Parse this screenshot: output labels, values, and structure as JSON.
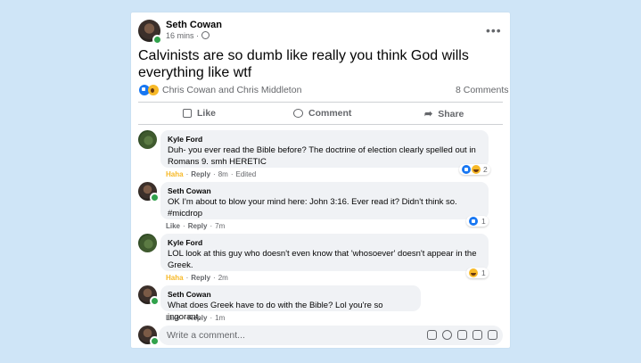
{
  "colors": {
    "background": "#cfe5f7",
    "haha": "#f7b928",
    "like": "#1877f2",
    "online": "#31a24c"
  },
  "post": {
    "author": "Seth Cowan",
    "time": "16 mins",
    "privacy_icon": "globe-icon",
    "more_label": "•••",
    "text": "Calvinists are so dumb like really you think God wills everything like wtf",
    "reactors": "Chris Cowan and Chris Middleton",
    "comments_count": "8 Comments",
    "actions": {
      "like": "Like",
      "comment": "Comment",
      "share": "Share"
    }
  },
  "comments": [
    {
      "author": "Kyle Ford",
      "text": "Duh- you ever read the Bible before? The doctrine of election clearly spelled out in Romans 9. smh HERETIC",
      "action": "Haha",
      "reply": "Reply",
      "time": "8m",
      "extra": "Edited",
      "reaction_count": "2"
    },
    {
      "author": "Seth Cowan",
      "text": "OK I'm about to blow your mind here: John 3:16. Ever read it? Didn't think so. #micdrop",
      "action": "Like",
      "reply": "Reply",
      "time": "7m",
      "reaction_count": "1"
    },
    {
      "author": "Kyle Ford",
      "text": "LOL look at this guy who doesn't even know that 'whosoever' doesn't appear in the Greek.",
      "action": "Haha",
      "reply": "Reply",
      "time": "2m",
      "reaction_count": "1"
    },
    {
      "author": "Seth Cowan",
      "text": "What does Greek have to do with the Bible? Lol you're so ingorant.",
      "action": "Like",
      "reply": "Reply",
      "time": "1m"
    }
  ],
  "composer": {
    "placeholder": "Write a comment..."
  }
}
